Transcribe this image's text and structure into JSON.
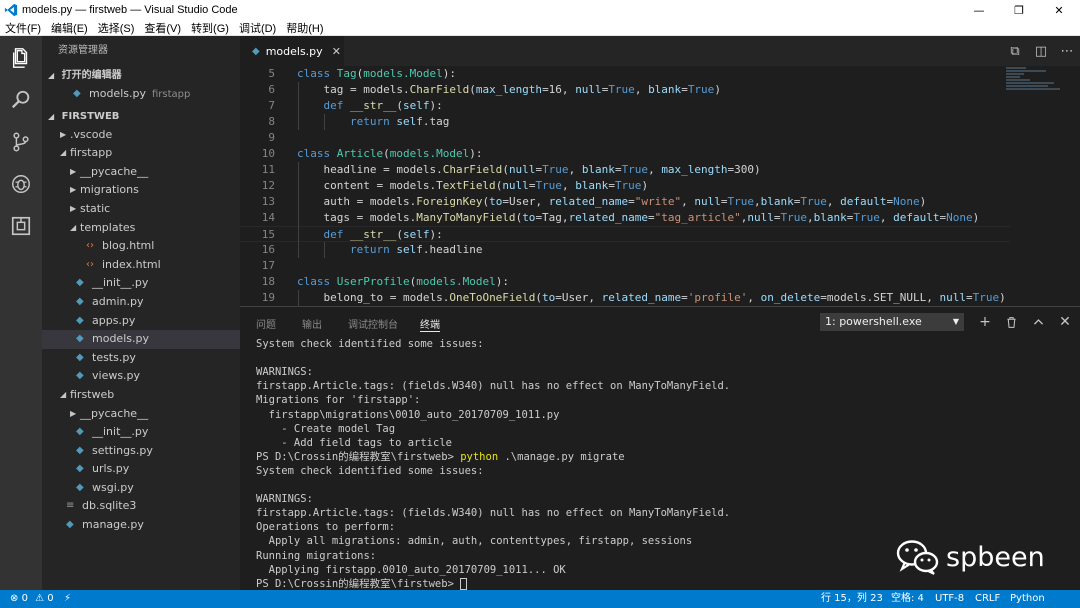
{
  "window": {
    "title": "models.py — firstweb — Visual Studio Code",
    "minimize": "—",
    "restore": "❐",
    "close": "✕"
  },
  "menu": [
    "文件(F)",
    "编辑(E)",
    "选择(S)",
    "查看(V)",
    "转到(G)",
    "调试(D)",
    "帮助(H)"
  ],
  "activity": [
    "explorer-icon",
    "search-icon",
    "source-control-icon",
    "debug-icon",
    "extensions-icon"
  ],
  "sidebar": {
    "title": "资源管理器",
    "open_editors_label": "打开的编辑器",
    "open_editor": {
      "name": "models.py",
      "hint": "firstapp"
    },
    "project_label": "FIRSTWEB",
    "tree": [
      {
        "name": ".vscode",
        "kind": "folder",
        "open": false,
        "depth": 1
      },
      {
        "name": "firstapp",
        "kind": "folder",
        "open": true,
        "depth": 1
      },
      {
        "name": "__pycache__",
        "kind": "folder",
        "open": false,
        "depth": 2
      },
      {
        "name": "migrations",
        "kind": "folder",
        "open": false,
        "depth": 2
      },
      {
        "name": "static",
        "kind": "folder",
        "open": false,
        "depth": 2
      },
      {
        "name": "templates",
        "kind": "folder",
        "open": true,
        "depth": 2
      },
      {
        "name": "blog.html",
        "kind": "html",
        "depth": 3
      },
      {
        "name": "index.html",
        "kind": "html",
        "depth": 3
      },
      {
        "name": "__init__.py",
        "kind": "py",
        "depth": 2
      },
      {
        "name": "admin.py",
        "kind": "py",
        "depth": 2
      },
      {
        "name": "apps.py",
        "kind": "py",
        "depth": 2
      },
      {
        "name": "models.py",
        "kind": "py",
        "depth": 2,
        "active": true
      },
      {
        "name": "tests.py",
        "kind": "py",
        "depth": 2
      },
      {
        "name": "views.py",
        "kind": "py",
        "depth": 2
      },
      {
        "name": "firstweb",
        "kind": "folder",
        "open": true,
        "depth": 1
      },
      {
        "name": "__pycache__",
        "kind": "folder",
        "open": false,
        "depth": 2
      },
      {
        "name": "__init__.py",
        "kind": "py",
        "depth": 2
      },
      {
        "name": "settings.py",
        "kind": "py",
        "depth": 2
      },
      {
        "name": "urls.py",
        "kind": "py",
        "depth": 2
      },
      {
        "name": "wsgi.py",
        "kind": "py",
        "depth": 2
      },
      {
        "name": "db.sqlite3",
        "kind": "file",
        "depth": 1
      },
      {
        "name": "manage.py",
        "kind": "py",
        "depth": 1
      }
    ]
  },
  "editor": {
    "tab_label": "models.py",
    "tab_close": "✕",
    "lines": [
      {
        "n": "5",
        "code": [
          [
            "kw",
            "class "
          ],
          [
            "cls",
            "Tag"
          ],
          [
            "",
            "("
          ],
          [
            "cls",
            "models.Model"
          ],
          [
            "",
            "):"
          ]
        ]
      },
      {
        "n": "6",
        "code": [
          [
            "",
            "    tag = models."
          ],
          [
            "fn",
            "CharField"
          ],
          [
            "",
            "("
          ],
          [
            "pm",
            "max_length"
          ],
          [
            "",
            "=16, "
          ],
          [
            "pm",
            "null"
          ],
          [
            "",
            "="
          ],
          [
            "const",
            "True"
          ],
          [
            "",
            ", "
          ],
          [
            "pm",
            "blank"
          ],
          [
            "",
            "="
          ],
          [
            "const",
            "True"
          ],
          [
            "",
            ")"
          ]
        ]
      },
      {
        "n": "7",
        "code": [
          [
            "",
            "    "
          ],
          [
            "kw",
            "def "
          ],
          [
            "fn",
            "__str__"
          ],
          [
            "",
            "("
          ],
          [
            "pm",
            "self"
          ],
          [
            "",
            "):"
          ]
        ]
      },
      {
        "n": "8",
        "code": [
          [
            "",
            "        "
          ],
          [
            "kw",
            "return "
          ],
          [
            "pm",
            "self"
          ],
          [
            "",
            ".tag"
          ]
        ]
      },
      {
        "n": "9",
        "code": []
      },
      {
        "n": "10",
        "code": [
          [
            "kw",
            "class "
          ],
          [
            "cls",
            "Article"
          ],
          [
            "",
            "("
          ],
          [
            "cls",
            "models.Model"
          ],
          [
            "",
            "):"
          ]
        ]
      },
      {
        "n": "11",
        "code": [
          [
            "",
            "    headline = models."
          ],
          [
            "fn",
            "CharField"
          ],
          [
            "",
            "("
          ],
          [
            "pm",
            "null"
          ],
          [
            "",
            "="
          ],
          [
            "const",
            "True"
          ],
          [
            "",
            ", "
          ],
          [
            "pm",
            "blank"
          ],
          [
            "",
            "="
          ],
          [
            "const",
            "True"
          ],
          [
            "",
            ", "
          ],
          [
            "pm",
            "max_length"
          ],
          [
            "",
            "=300)"
          ]
        ]
      },
      {
        "n": "12",
        "code": [
          [
            "",
            "    content = models."
          ],
          [
            "fn",
            "TextField"
          ],
          [
            "",
            "("
          ],
          [
            "pm",
            "null"
          ],
          [
            "",
            "="
          ],
          [
            "const",
            "True"
          ],
          [
            "",
            ", "
          ],
          [
            "pm",
            "blank"
          ],
          [
            "",
            "="
          ],
          [
            "const",
            "True"
          ],
          [
            "",
            ")"
          ]
        ]
      },
      {
        "n": "13",
        "code": [
          [
            "",
            "    auth = models."
          ],
          [
            "fn",
            "ForeignKey"
          ],
          [
            "",
            "("
          ],
          [
            "pm",
            "to"
          ],
          [
            "",
            "=User, "
          ],
          [
            "pm",
            "related_name"
          ],
          [
            "",
            "="
          ],
          [
            "str",
            "\"write\""
          ],
          [
            "",
            ", "
          ],
          [
            "pm",
            "null"
          ],
          [
            "",
            "="
          ],
          [
            "const",
            "True"
          ],
          [
            "",
            ","
          ],
          [
            "pm",
            "blank"
          ],
          [
            "",
            "="
          ],
          [
            "const",
            "True"
          ],
          [
            "",
            ", "
          ],
          [
            "pm",
            "default"
          ],
          [
            "",
            "="
          ],
          [
            "const",
            "None"
          ],
          [
            "",
            ")"
          ]
        ]
      },
      {
        "n": "14",
        "code": [
          [
            "",
            "    tags = models."
          ],
          [
            "fn",
            "ManyToManyField"
          ],
          [
            "",
            "("
          ],
          [
            "pm",
            "to"
          ],
          [
            "",
            "=Tag,"
          ],
          [
            "pm",
            "related_name"
          ],
          [
            "",
            "="
          ],
          [
            "str",
            "\"tag_article\""
          ],
          [
            "",
            ","
          ],
          [
            "pm",
            "null"
          ],
          [
            "",
            "="
          ],
          [
            "const",
            "True"
          ],
          [
            "",
            ","
          ],
          [
            "pm",
            "blank"
          ],
          [
            "",
            "="
          ],
          [
            "const",
            "True"
          ],
          [
            "",
            ", "
          ],
          [
            "pm",
            "default"
          ],
          [
            "",
            "="
          ],
          [
            "const",
            "None"
          ],
          [
            "",
            ")"
          ]
        ]
      },
      {
        "n": "15",
        "code": [
          [
            "",
            "    "
          ],
          [
            "kw",
            "def "
          ],
          [
            "fn",
            "__str__"
          ],
          [
            "",
            "("
          ],
          [
            "pm",
            "self"
          ],
          [
            "",
            "):"
          ]
        ],
        "current": true
      },
      {
        "n": "16",
        "code": [
          [
            "",
            "        "
          ],
          [
            "kw",
            "return "
          ],
          [
            "pm",
            "self"
          ],
          [
            "",
            ".headline"
          ]
        ]
      },
      {
        "n": "17",
        "code": []
      },
      {
        "n": "18",
        "code": [
          [
            "kw",
            "class "
          ],
          [
            "cls",
            "UserProfile"
          ],
          [
            "",
            "("
          ],
          [
            "cls",
            "models.Model"
          ],
          [
            "",
            "):"
          ]
        ]
      },
      {
        "n": "19",
        "code": [
          [
            "",
            "    belong_to = models."
          ],
          [
            "fn",
            "OneToOneField"
          ],
          [
            "",
            "("
          ],
          [
            "pm",
            "to"
          ],
          [
            "",
            "=User, "
          ],
          [
            "pm",
            "related_name"
          ],
          [
            "",
            "="
          ],
          [
            "str",
            "'profile'"
          ],
          [
            "",
            ", "
          ],
          [
            "pm",
            "on_delete"
          ],
          [
            "",
            "=models.SET_NULL, "
          ],
          [
            "pm",
            "null"
          ],
          [
            "",
            "="
          ],
          [
            "const",
            "True"
          ],
          [
            "",
            ")"
          ]
        ]
      }
    ]
  },
  "panel": {
    "tabs": [
      "问题",
      "输出",
      "调试控制台",
      "终端"
    ],
    "active_tab": 3,
    "terminal_select": "1: powershell.exe",
    "add": "+",
    "trash": "🗑",
    "maximize": "⌃",
    "close": "✕",
    "lines": [
      {
        "text": "System check identified some issues:"
      },
      {
        "text": ""
      },
      {
        "text": "WARNINGS:"
      },
      {
        "text": "firstapp.Article.tags: (fields.W340) null has no effect on ManyToManyField."
      },
      {
        "text": "Migrations for 'firstapp':"
      },
      {
        "text": "  firstapp\\migrations\\0010_auto_20170709_1011.py"
      },
      {
        "text": "    - Create model Tag"
      },
      {
        "text": "    - Add field tags to article"
      },
      {
        "prompt": "PS D:\\Crossin的编程教室\\firstweb> ",
        "cmd": "python",
        "rest": " .\\manage.py migrate"
      },
      {
        "text": "System check identified some issues:"
      },
      {
        "text": ""
      },
      {
        "text": "WARNINGS:"
      },
      {
        "text": "firstapp.Article.tags: (fields.W340) null has no effect on ManyToManyField."
      },
      {
        "text": "Operations to perform:"
      },
      {
        "text": "  Apply all migrations: admin, auth, contenttypes, firstapp, sessions"
      },
      {
        "text": "Running migrations:"
      },
      {
        "text": "  Applying firstapp.0010_auto_20170709_1011... OK"
      },
      {
        "prompt": "PS D:\\Crossin的编程教室\\firstweb> ",
        "cursor": true
      }
    ]
  },
  "watermark": {
    "text": "spbeen",
    "icon": "wechat-icon"
  },
  "status": {
    "errors": "0",
    "warnings": "0",
    "position": "行 15，列 23",
    "indent": "空格: 4",
    "encoding": "UTF-8",
    "eol": "CRLF",
    "language": "Python"
  },
  "colors": {
    "statusbar": "#007acc",
    "activitybar": "#333333",
    "sidebar": "#252526",
    "editor": "#1e1e1e",
    "accent_cmd": "#e5e510"
  }
}
